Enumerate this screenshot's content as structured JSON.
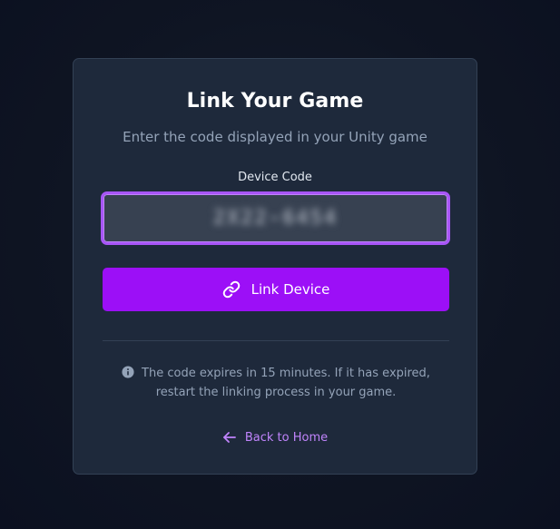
{
  "card": {
    "title": "Link Your Game",
    "subtitle": "Enter the code displayed in your Unity game"
  },
  "form": {
    "code_label": "Device Code",
    "code_value": "2X22-6454",
    "submit_label": "Link Device",
    "submit_icon": "link-icon"
  },
  "info": {
    "icon": "info-icon",
    "text": "The code expires in 15 minutes. If it has expired, restart the linking process in your game."
  },
  "footer": {
    "back_label": "Back to Home",
    "back_icon": "arrow-left-icon"
  },
  "colors": {
    "accent": "#9c0ff7",
    "accent_border": "#a855f7",
    "link_text": "#c084fc",
    "card_bg": "#1e293b"
  }
}
